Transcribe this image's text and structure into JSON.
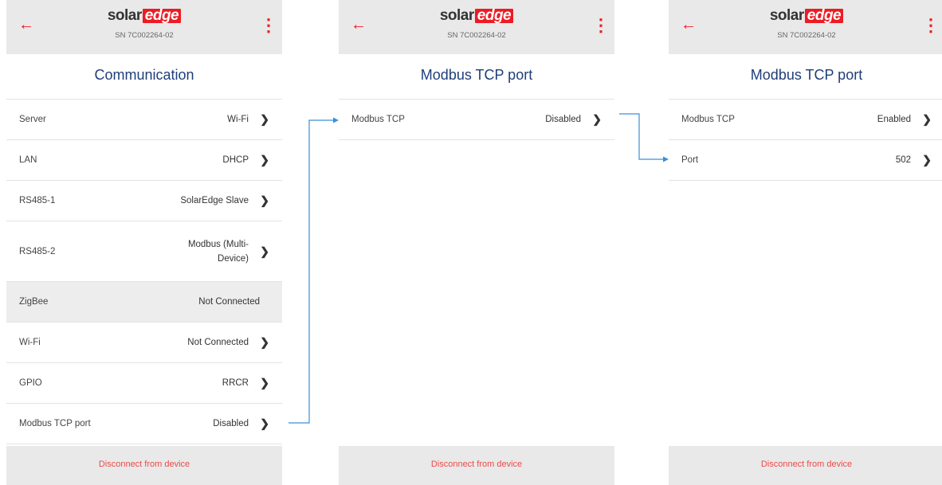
{
  "brand": {
    "logo_word": "solar",
    "logo_highlight": "edge",
    "accent_color": "#ec1c24",
    "title_color": "#1f3e7a"
  },
  "screens": [
    {
      "serial": "SN 7C002264-02",
      "title": "Communication",
      "rows": [
        {
          "label": "Server",
          "value": "Wi-Fi"
        },
        {
          "label": "LAN",
          "value": "DHCP"
        },
        {
          "label": "RS485-1",
          "value": "SolarEdge Slave"
        },
        {
          "label": "RS485-2",
          "value_line1": "Modbus (Multi-",
          "value_line2": "Device)"
        },
        {
          "label": "ZigBee",
          "value": "Not Connected"
        },
        {
          "label": "Wi-Fi",
          "value": "Not Connected"
        },
        {
          "label": "GPIO",
          "value": "RRCR"
        },
        {
          "label": "Modbus TCP port",
          "value": "Disabled"
        }
      ],
      "footer": "Disconnect from device"
    },
    {
      "serial": "SN 7C002264-02",
      "title": "Modbus TCP port",
      "rows": [
        {
          "label": "Modbus TCP",
          "value": "Disabled"
        }
      ],
      "footer": "Disconnect from device"
    },
    {
      "serial": "SN 7C002264-02",
      "title": "Modbus TCP port",
      "rows": [
        {
          "label": "Modbus TCP",
          "value": "Enabled"
        },
        {
          "label": "Port",
          "value": "502"
        }
      ],
      "footer": "Disconnect from device"
    }
  ],
  "icons": {
    "back": "arrow-left-icon",
    "menu": "more-vertical-icon",
    "chevron": "chevron-right-icon",
    "connector": "arrow-right-icon"
  },
  "connector_color": "#3a8fd9"
}
